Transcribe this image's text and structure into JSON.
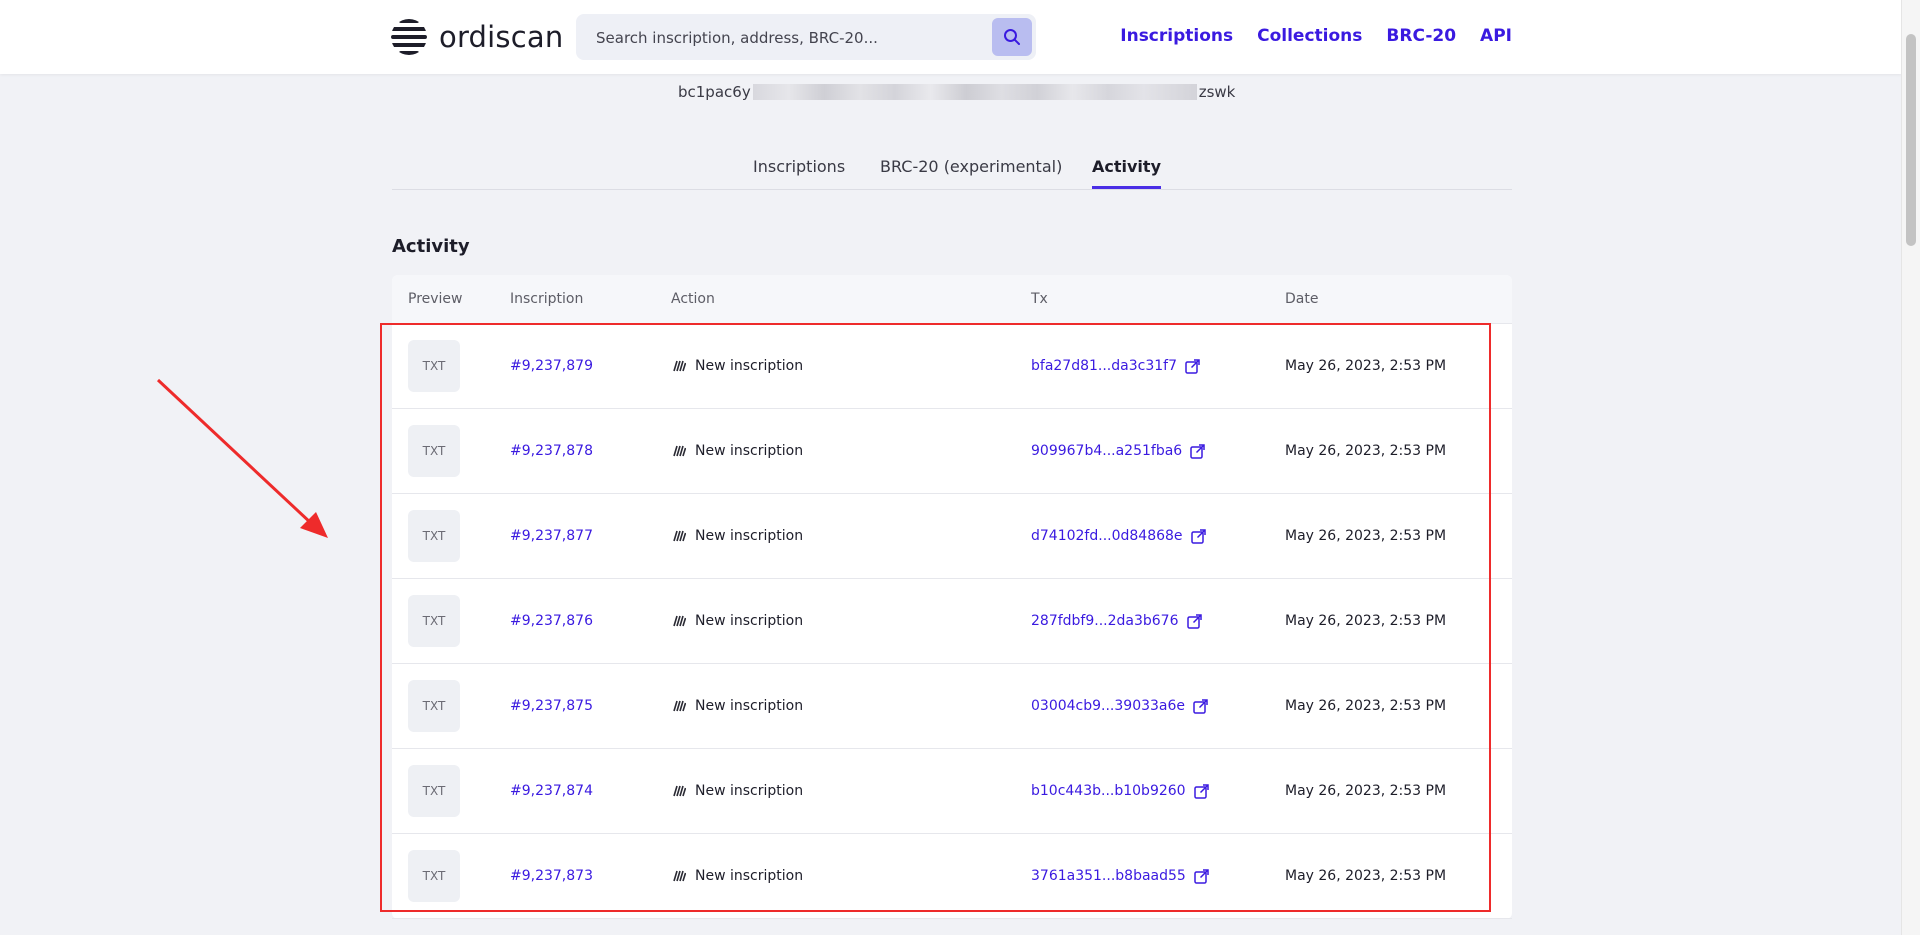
{
  "brand": {
    "name": "ordiscan"
  },
  "search": {
    "placeholder": "Search inscription, address, BRC-20..."
  },
  "nav": [
    "Inscriptions",
    "Collections",
    "BRC-20",
    "API"
  ],
  "address": {
    "prefix": "bc1pac6y",
    "suffix": "zswk"
  },
  "tabs": [
    {
      "label": "Inscriptions",
      "active": false
    },
    {
      "label": "BRC-20 (experimental)",
      "active": true
    },
    {
      "label": "Activity",
      "active": true
    }
  ],
  "section_title": "Activity",
  "table": {
    "headers": [
      "Preview",
      "Inscription",
      "Action",
      "Tx",
      "Date"
    ],
    "rows": [
      {
        "preview": "TXT",
        "inscription": "#9,237,879",
        "action": "New inscription",
        "tx": "bfa27d81...da3c31f7",
        "date": "May 26, 2023, 2:53 PM"
      },
      {
        "preview": "TXT",
        "inscription": "#9,237,878",
        "action": "New inscription",
        "tx": "909967b4...a251fba6",
        "date": "May 26, 2023, 2:53 PM"
      },
      {
        "preview": "TXT",
        "inscription": "#9,237,877",
        "action": "New inscription",
        "tx": "d74102fd...0d84868e",
        "date": "May 26, 2023, 2:53 PM"
      },
      {
        "preview": "TXT",
        "inscription": "#9,237,876",
        "action": "New inscription",
        "tx": "287fdbf9...2da3b676",
        "date": "May 26, 2023, 2:53 PM"
      },
      {
        "preview": "TXT",
        "inscription": "#9,237,875",
        "action": "New inscription",
        "tx": "03004cb9...39033a6e",
        "date": "May 26, 2023, 2:53 PM"
      },
      {
        "preview": "TXT",
        "inscription": "#9,237,874",
        "action": "New inscription",
        "tx": "b10c443b...b10b9260",
        "date": "May 26, 2023, 2:53 PM"
      },
      {
        "preview": "TXT",
        "inscription": "#9,237,873",
        "action": "New inscription",
        "tx": "3761a351...b8baad55",
        "date": "May 26, 2023, 2:53 PM"
      }
    ]
  },
  "colors": {
    "accent": "#3a1ae0",
    "annotation": "#ee2b2b",
    "background": "#f1f2f6"
  }
}
